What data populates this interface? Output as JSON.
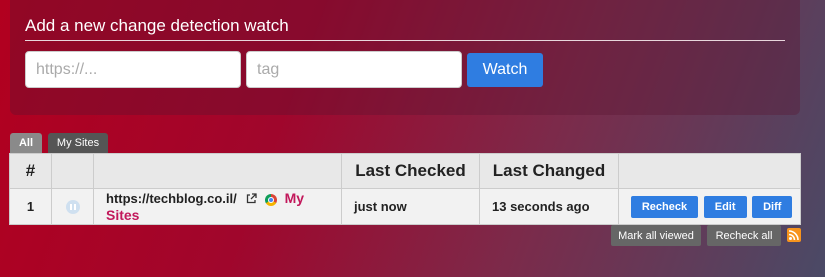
{
  "add_watch": {
    "title": "Add a new change detection watch",
    "url_placeholder": "https://...",
    "tag_placeholder": "tag",
    "watch_label": "Watch"
  },
  "tabs": [
    {
      "label": "All",
      "active": true
    },
    {
      "label": "My Sites",
      "active": false
    }
  ],
  "table": {
    "headers": [
      "#",
      "",
      "",
      "Last Checked",
      "Last Changed",
      ""
    ],
    "rows": [
      {
        "index": "1",
        "url": "https://techblog.co.il/",
        "tag": "My Sites",
        "last_checked": "just now",
        "last_changed": "13 seconds ago",
        "actions": [
          "Recheck",
          "Edit",
          "Diff"
        ]
      }
    ]
  },
  "footer": {
    "mark_all_viewed": "Mark all viewed",
    "recheck_all": "Recheck all"
  },
  "colors": {
    "accent": "#2f7de1",
    "tag": "#c2185b",
    "rss": "#f7941d"
  },
  "icons": [
    "pause-icon",
    "external-link-icon",
    "chrome-icon",
    "rss-icon"
  ]
}
